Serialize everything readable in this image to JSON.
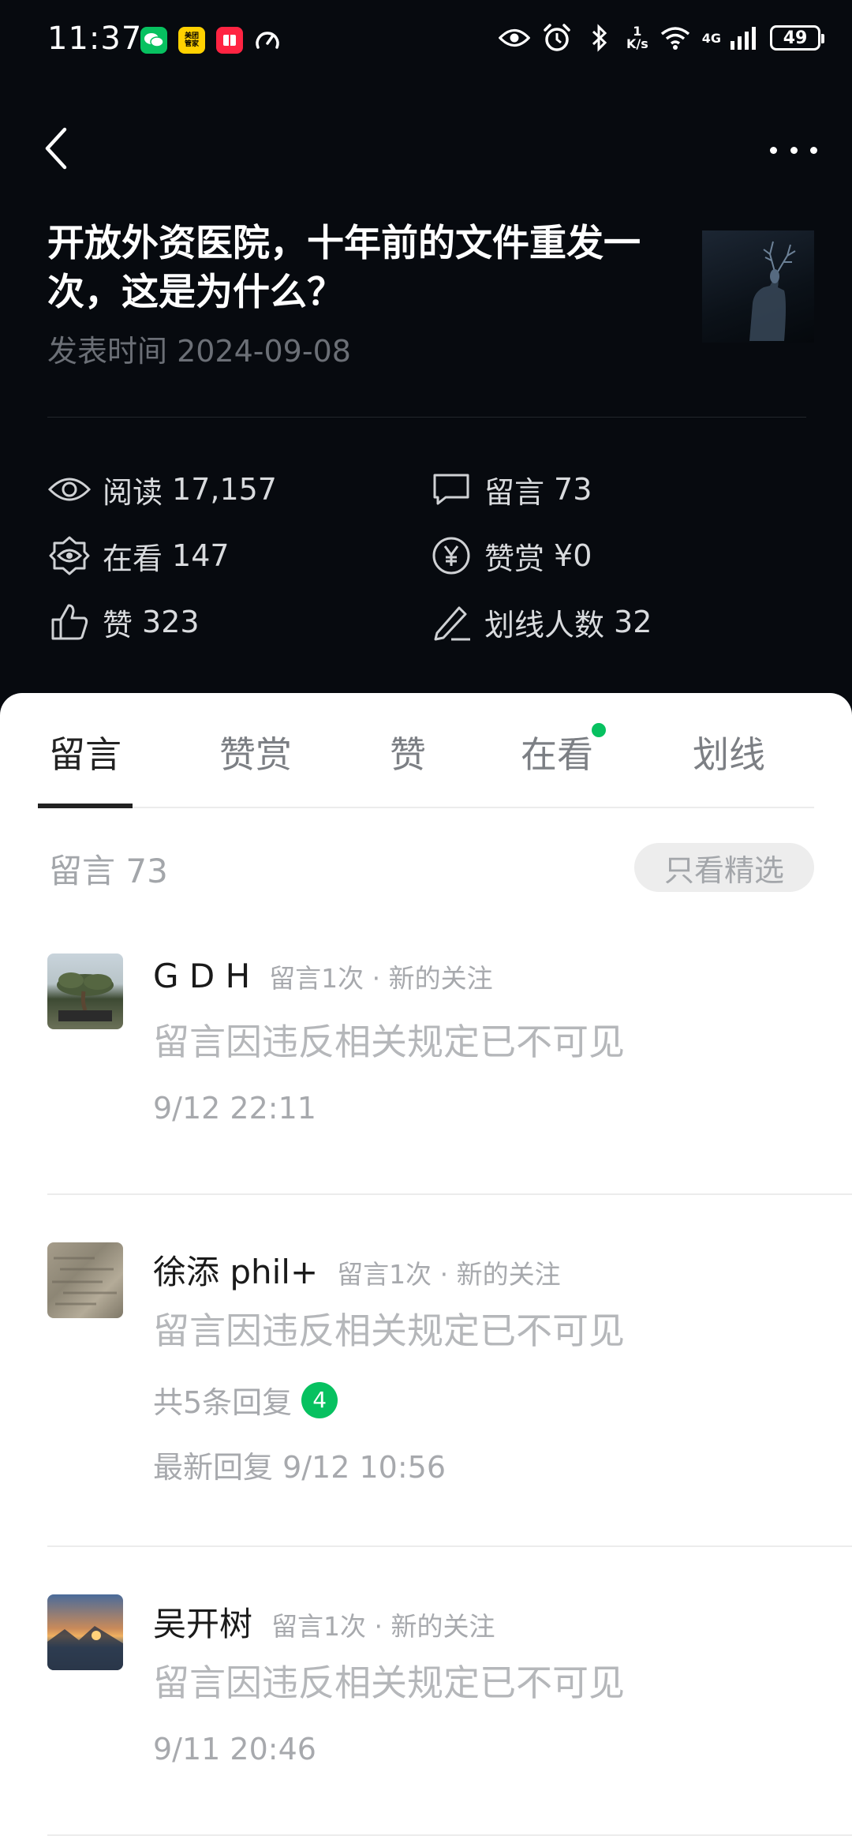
{
  "status_bar": {
    "time": "11:37",
    "apps": [
      {
        "name": "wechat-icon",
        "color": "#07c160"
      },
      {
        "name": "meituan-icon",
        "color": "#ffd100",
        "label": "美团\n管家"
      },
      {
        "name": "red-book-icon",
        "color": "#ff2442"
      },
      {
        "name": "speedometer-icon",
        "color": "#ffffff"
      }
    ],
    "net_speed_value": "1",
    "net_speed_unit": "K/s",
    "network": "4G",
    "battery": "49"
  },
  "header": {
    "title": "开放外资医院，十年前的文件重发一次，这是为什么？",
    "published": "发表时间 2024-09-08"
  },
  "stats": {
    "read": {
      "label": "阅读",
      "value": "17,157"
    },
    "comment": {
      "label": "留言",
      "value": "73"
    },
    "watching": {
      "label": "在看",
      "value": "147"
    },
    "reward": {
      "label": "赞赏",
      "value": "¥0"
    },
    "like": {
      "label": "赞",
      "value": "323"
    },
    "underline": {
      "label": "划线人数",
      "value": "32"
    }
  },
  "tabs": [
    {
      "label": "留言",
      "active": true
    },
    {
      "label": "赞赏"
    },
    {
      "label": "赞"
    },
    {
      "label": "在看",
      "dot": true
    },
    {
      "label": "划线"
    }
  ],
  "comments_section": {
    "count_label": "留言 73",
    "filter_button": "只看精选"
  },
  "comments": [
    {
      "name": "G D H",
      "meta": "留言1次 · 新的关注",
      "text": "留言因违反相关规定已不可见",
      "time": "9/12 22:11"
    },
    {
      "name": "徐添 phil+",
      "meta": "留言1次 · 新的关注",
      "text": "留言因违反相关规定已不可见",
      "replies": "共5条回复",
      "reply_badge": "4",
      "time": "最新回复 9/12 10:56"
    },
    {
      "name": "吴开树",
      "meta": "留言1次 · 新的关注",
      "text": "留言因违反相关规定已不可见",
      "time": "9/11 20:46"
    }
  ],
  "colors": {
    "header_bg": "#070a0f",
    "accent_green": "#07c160",
    "muted_text": "#a7a9ad"
  }
}
